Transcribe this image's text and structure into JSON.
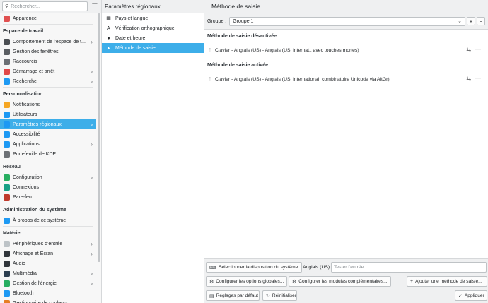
{
  "search": {
    "placeholder": "Rechercher..."
  },
  "sidebar": {
    "top_item": {
      "label": "Apparence",
      "color": "#e05050"
    },
    "categories": [
      {
        "label": "Espace de travail",
        "items": [
          {
            "label": "Comportement de l'espace de t...",
            "color": "#4b4f53",
            "chevron": true
          },
          {
            "label": "Gestion des fenêtres",
            "color": "#5a5e62",
            "chevron": false
          },
          {
            "label": "Raccourcis",
            "color": "#6c7075",
            "chevron": false
          },
          {
            "label": "Démarrage et arrêt",
            "color": "#e04848",
            "chevron": true
          },
          {
            "label": "Recherche",
            "color": "#1d99f3",
            "chevron": true
          }
        ]
      },
      {
        "label": "Personnalisation",
        "items": [
          {
            "label": "Notifications",
            "color": "#f5a623",
            "chevron": false
          },
          {
            "label": "Utilisateurs",
            "color": "#1d99f3",
            "chevron": false
          },
          {
            "label": "Paramètres régionaux",
            "color": "#1d99f3",
            "chevron": true,
            "selected": true
          },
          {
            "label": "Accessibilité",
            "color": "#1d99f3",
            "chevron": false
          },
          {
            "label": "Applications",
            "color": "#1d99f3",
            "chevron": true
          },
          {
            "label": "Portefeuille de KDE",
            "color": "#6c7075",
            "chevron": false
          }
        ]
      },
      {
        "label": "Réseau",
        "items": [
          {
            "label": "Configuration",
            "color": "#27ae60",
            "chevron": true
          },
          {
            "label": "Connexions",
            "color": "#16a085",
            "chevron": false
          },
          {
            "label": "Pare-feu",
            "color": "#c0392b",
            "chevron": false
          }
        ]
      },
      {
        "label": "Administration du système",
        "items": [
          {
            "label": "À propos de ce système",
            "color": "#1d99f3",
            "chevron": false
          }
        ]
      },
      {
        "label": "Matériel",
        "items": [
          {
            "label": "Périphériques d'entrée",
            "color": "#bdc3c7",
            "chevron": true
          },
          {
            "label": "Affichage et Écran",
            "color": "#31363b",
            "chevron": true
          },
          {
            "label": "Audio",
            "color": "#31363b",
            "chevron": false
          },
          {
            "label": "Multimédia",
            "color": "#2c3e50",
            "chevron": true
          },
          {
            "label": "Gestion de l'énergie",
            "color": "#27ae60",
            "chevron": true
          },
          {
            "label": "Bluetooth",
            "color": "#1d99f3",
            "chevron": false
          },
          {
            "label": "Gestionnaire de couleurs",
            "color": "#e67e22",
            "chevron": false
          }
        ]
      }
    ]
  },
  "midpanel": {
    "title": "Paramètres régionaux",
    "items": [
      {
        "label": "Pays et langue",
        "icon": "flag-icon"
      },
      {
        "label": "Vérification orthographique",
        "icon": "spellcheck-icon"
      },
      {
        "label": "Date et heure",
        "icon": "clock-icon"
      },
      {
        "label": "Méthode de saisie",
        "icon": "keyboard-penguin-icon",
        "selected": true
      }
    ]
  },
  "content": {
    "title": "Méthode de saisie",
    "group_label": "Groupe :",
    "group_value": "Groupe 1",
    "disabled_section": "Méthode de saisie désactivée",
    "disabled_method": "Clavier - Anglais (US) - Anglais (US, internat., avec touches mortes)",
    "enabled_section": "Méthode de saisie activée",
    "enabled_method": "Clavier - Anglais (US) - Anglais (US, international, combinatoire Unicode via AltGr)"
  },
  "bottom": {
    "select_layout": "Sélectionner la disposition du système...",
    "test_layout_label": "Anglais (US)",
    "test_placeholder": "Tester l'entrée",
    "global_options": "Configurer les options globales...",
    "addons": "Configurer les modules complémentaires...",
    "add_method": "Ajouter une méthode de saisie...",
    "defaults": "Réglages par défaut",
    "reset": "Réinitialiser",
    "apply": "Appliquer"
  },
  "colors": {
    "accent": "#3daee9"
  }
}
